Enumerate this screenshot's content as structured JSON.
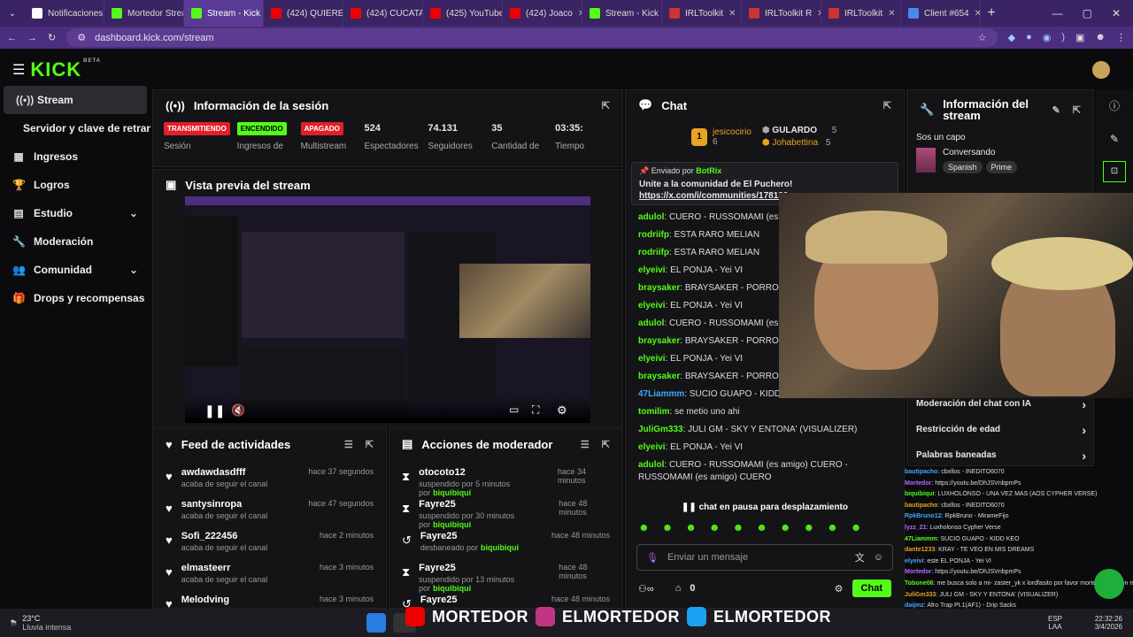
{
  "browser": {
    "tabs": [
      "Notificaciones",
      "Mortedor Stream",
      "Stream - Kick",
      "(424) QUIERE",
      "(424) CUCATA",
      "(425) YouTube",
      "(424) Joaco",
      "Stream - Kick",
      "IRLToolkit",
      "IRLToolkit R",
      "IRLToolkit",
      "Client #654"
    ],
    "url": "dashboard.kick.com/stream"
  },
  "brand": {
    "logo": "KICK",
    "beta": "BETA"
  },
  "sidebar": [
    {
      "label": "Stream",
      "icon": "broadcast-icon"
    },
    {
      "label": "Servidor y clave de retransmisión",
      "icon": ""
    },
    {
      "label": "Ingresos",
      "icon": "dollar-icon"
    },
    {
      "label": "Logros",
      "icon": "trophy-icon"
    },
    {
      "label": "Estudio",
      "icon": "grid-icon",
      "chev": true
    },
    {
      "label": "Moderación",
      "icon": "wrench-icon"
    },
    {
      "label": "Comunidad",
      "icon": "people-icon",
      "chev": true
    },
    {
      "label": "Drops y recompensas",
      "icon": "gift-icon"
    }
  ],
  "session": {
    "title": "Información de la sesión",
    "stats": [
      {
        "badge": "TRANSMITIENDO",
        "kind": "red",
        "label": "Sesión"
      },
      {
        "badge": "ENCENDIDO",
        "kind": "green",
        "label": "Ingresos de"
      },
      {
        "badge": "APAGADO",
        "kind": "red",
        "label": "Multistream"
      },
      {
        "value": "524",
        "label": "Espectadores"
      },
      {
        "value": "74.131",
        "label": "Seguidores"
      },
      {
        "value": "35",
        "label": "Cantidad de"
      },
      {
        "value": "03:35:",
        "label": "Tiempo"
      }
    ]
  },
  "preview": {
    "title": "Vista previa del stream"
  },
  "feed": {
    "title": "Feed de actividades",
    "items": [
      {
        "name": "awdawdasdfff",
        "sub": "acaba de seguir el canal",
        "time": "hace 37 segundos"
      },
      {
        "name": "santysinropa",
        "sub": "acaba de seguir el canal",
        "time": "hace 47 segundos"
      },
      {
        "name": "Sofi_222456",
        "sub": "acaba de seguir el canal",
        "time": "hace 2 minutos"
      },
      {
        "name": "elmasteerr",
        "sub": "acaba de seguir el canal",
        "time": "hace 3 minutos"
      },
      {
        "name": "Melodving",
        "sub": "",
        "time": "hace 3 minutos"
      }
    ]
  },
  "modactions": {
    "title": "Acciones de moderador",
    "items": [
      {
        "icon": "hourglass-icon",
        "name": "otocoto12",
        "sub": "suspendido por 5 minutos por",
        "by": "biquibiqui",
        "time": "hace 34 minutos"
      },
      {
        "icon": "hourglass-icon",
        "name": "Fayre25",
        "sub": "suspendido por 30 minutos por",
        "by": "biquibiqui",
        "time": "hace 48 minutos"
      },
      {
        "icon": "undo-icon",
        "name": "Fayre25",
        "sub": "desbaneado por",
        "by": "biquibiqui",
        "time": "hace 48 minutos"
      },
      {
        "icon": "hourglass-icon",
        "name": "Fayre25",
        "sub": "suspendido por 13 minutos por",
        "by": "biquibiqui",
        "time": "hace 48 minutos"
      },
      {
        "icon": "undo-icon",
        "name": "Fayre25",
        "sub": "",
        "by": "",
        "time": "hace 48 minutos"
      }
    ]
  },
  "chat": {
    "title": "Chat",
    "top": [
      {
        "name": "jesicocirio",
        "count": "6"
      },
      {
        "name": "GULARDO",
        "count": "5"
      },
      {
        "name": "Johabettina",
        "count": "5"
      }
    ],
    "pinned": {
      "by": "Enviado por",
      "user": "BotRix",
      "text": "Unite a la comunidad de El Puchero!",
      "link": "https://x.com/i/communities/178139"
    },
    "messages": [
      {
        "u": "adulol",
        "c": "#53fc18",
        "t": "CUERO - RUSSOMAMI (es amigo)"
      },
      {
        "u": "rodriifp",
        "c": "#53fc18",
        "t": "ESTA RARO MELIAN"
      },
      {
        "u": "rodriifp",
        "c": "#53fc18",
        "t": "ESTA RARO MELIAN"
      },
      {
        "u": "elyeivi",
        "c": "#53fc18",
        "t": "EL PONJA - Yei VI"
      },
      {
        "u": "braysaker",
        "c": "#53fc18",
        "t": "BRAYSAKER - PORRO GORDO"
      },
      {
        "u": "elyeivi",
        "c": "#53fc18",
        "t": "EL PONJA - Yei VI"
      },
      {
        "u": "adulol",
        "c": "#53fc18",
        "t": "CUERO - RUSSOMAMI (es amigo)"
      },
      {
        "u": "braysaker",
        "c": "#53fc18",
        "t": "BRAYSAKER - PORRO GORDO"
      },
      {
        "u": "elyeivi",
        "c": "#53fc18",
        "t": "EL PONJA - Yei VI"
      },
      {
        "u": "braysaker",
        "c": "#53fc18",
        "t": "BRAYSAKER - PORRO GORDO"
      },
      {
        "u": "47Liammm",
        "c": "#3fa9ff",
        "t": "SUCIO GUAPO - KIDD KEO"
      },
      {
        "u": "tomilim",
        "c": "#53fc18",
        "t": "se metio uno ahi"
      },
      {
        "u": "JuliGm333",
        "c": "#53fc18",
        "t": "JULI GM - SKY Y ENTONA' (VISUALIZER)"
      },
      {
        "u": "elyeivi",
        "c": "#53fc18",
        "t": "EL PONJA - Yei VI"
      },
      {
        "u": "adulol",
        "c": "#53fc18",
        "t": "CUERO - RUSSOMAMI (es amigo) CUERO - RUSSOMAMI (es amigo) CUERO"
      }
    ],
    "paused": "chat en pausa para desplazamiento",
    "placeholder": "Enviar un mensaje",
    "viewers": "0",
    "send": "Chat"
  },
  "streaminfo": {
    "title": "Información del stream",
    "capo": "Sos un capo",
    "category": "Conversando",
    "tags": [
      "Spanish",
      "Prime"
    ],
    "settings": [
      "Moderación del chat con IA",
      "Restricción de edad",
      "Palabras baneadas"
    ]
  },
  "minichat": [
    {
      "u": "bautipacho",
      "t": "cbxllos - INEDITO6070"
    },
    {
      "u": "Mortedor",
      "t": "https://youtu.be/DhJSVnbpmPs"
    },
    {
      "u": "biquibiqui",
      "t": "LUXHOLONSO - UNA VEZ MAS (AOS CYPHER VERSE)"
    },
    {
      "u": "bautipacho",
      "t": "cbxllos - INEDITO6070"
    },
    {
      "u": "RpkBruno12",
      "t": "RpkBruno - MirameFijo"
    },
    {
      "u": "lyzz_21",
      "t": "Luxholonso Cypher Verse"
    },
    {
      "u": "47Liammm",
      "t": "SUCIO GUAPO - KIDD KEO"
    },
    {
      "u": "dante1233",
      "t": "KRAY - TE VEO EN MIS DREAMS"
    },
    {
      "u": "elyeivi",
      "t": "este EL PONJA - Yei VI"
    },
    {
      "u": "Mortedor",
      "t": "https://youtu.be/DhJSVnbpmPs"
    },
    {
      "u": "Tobone06",
      "t": "me busca solo a mi- zaster_yk x lordfasito por favor morte, lo sacaron mis amigos hey"
    },
    {
      "u": "JuliGm333",
      "t": "JULI GM - SKY Y ENTONA' (VISUALIZER)"
    },
    {
      "u": "daijmz",
      "t": "Afro Trap Pt.1(AF1) - Drip Sacks"
    }
  ],
  "overlay": {
    "yt": "MORTEDOR",
    "ig": "ELMORTEDOR",
    "tw": "ELMORTEDOR"
  },
  "taskbar": {
    "temp": "23°C",
    "weather": "Lluvia intensa",
    "lang": "ESP",
    "layout": "LAA",
    "time": "22:32:26",
    "date": "3/4/2026"
  }
}
